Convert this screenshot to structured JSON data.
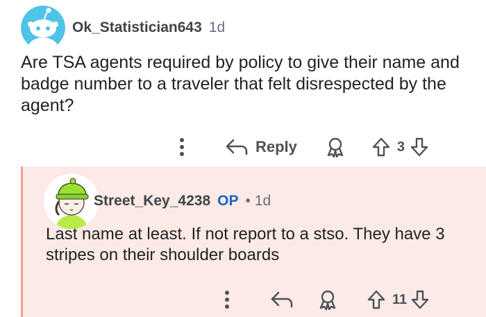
{
  "parent_comment": {
    "username": "Ok_Statistician643",
    "age": "1d",
    "text": "Are TSA agents required by policy to give their name and badge number to a traveler that felt disrespected by the agent?",
    "reply_label": "Reply",
    "vote_count": "3",
    "icons": [
      "more-options-icon",
      "reply-arrow-icon",
      "award-icon",
      "upvote-icon",
      "downvote-icon"
    ]
  },
  "reply_comment": {
    "username": "Street_Key_4238",
    "op_badge": "OP",
    "separator": "•",
    "age": "1d",
    "text": "Last name at least. If not report to a stso. They have 3 stripes on their shoulder boards",
    "vote_count": "11",
    "icons": [
      "more-options-icon",
      "reply-arrow-icon",
      "award-icon",
      "upvote-icon",
      "downvote-icon"
    ]
  },
  "colors": {
    "reply_background": "#fbeae6",
    "thread_line": "#f2a191",
    "op_badge": "#1f63c4",
    "avatar_parent": "#4fc3e8",
    "avatar_hat": "#9adf2f"
  }
}
